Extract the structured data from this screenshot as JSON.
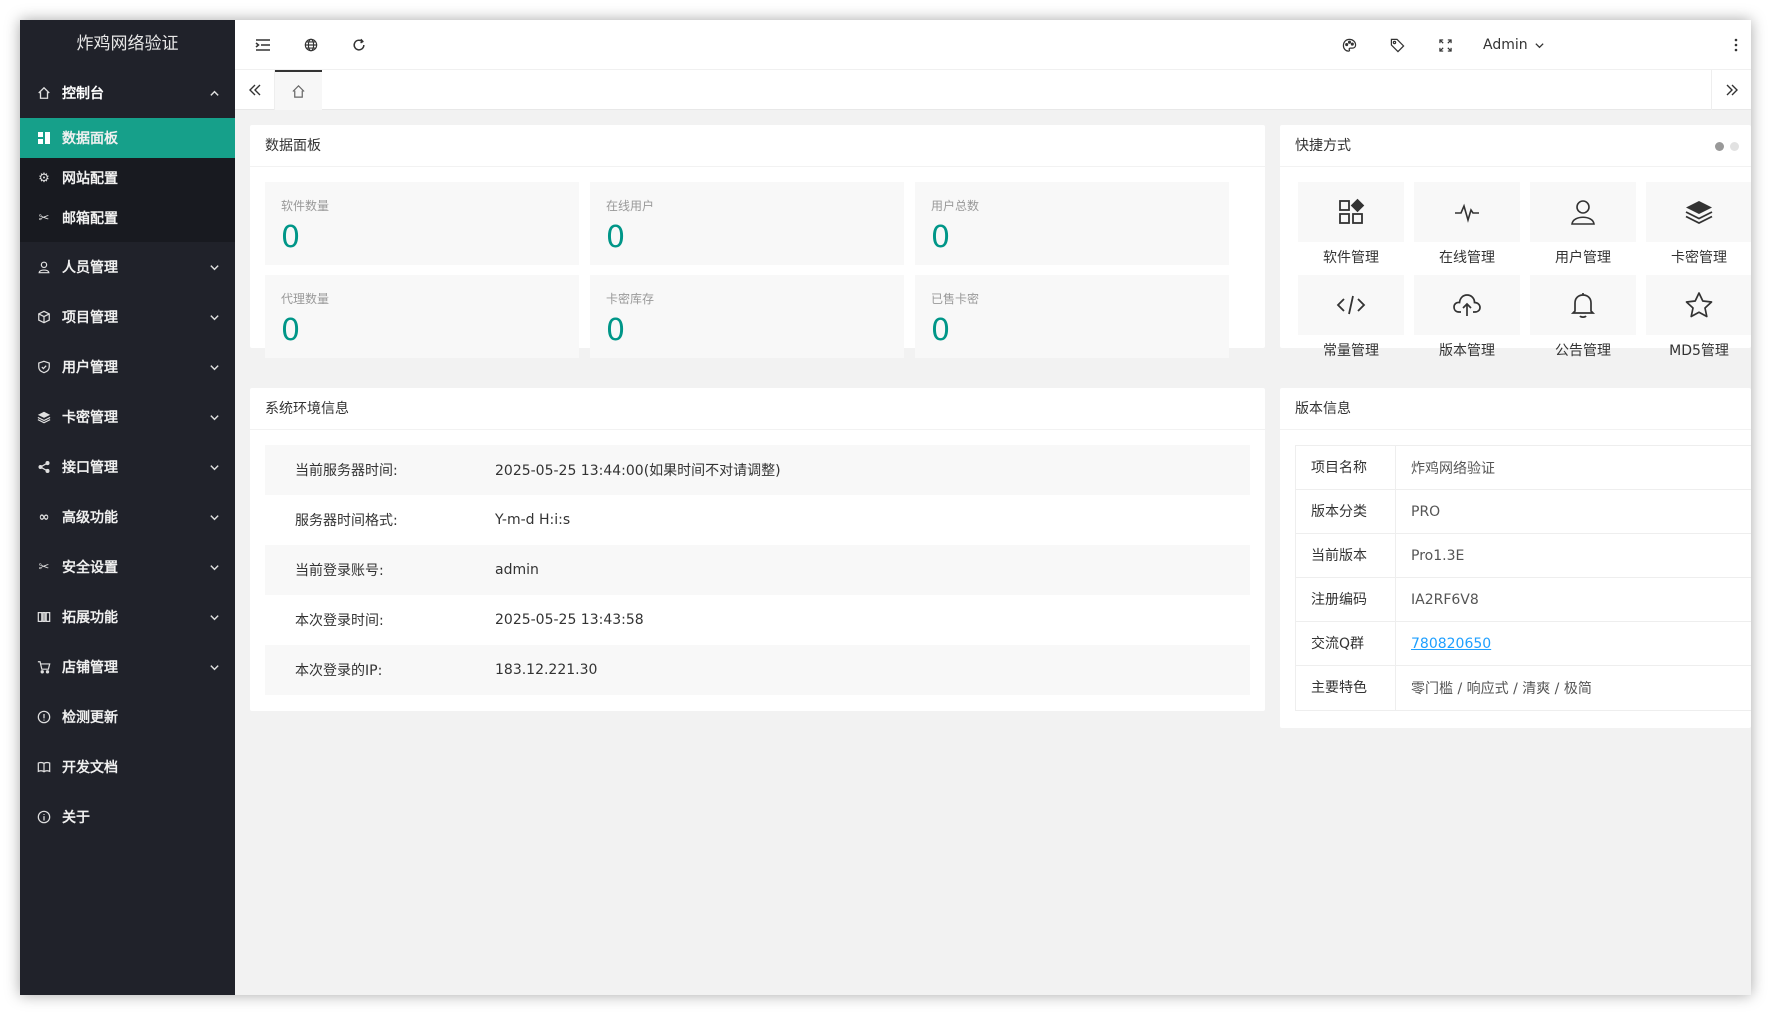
{
  "app": {
    "title": "炸鸡网络验证"
  },
  "sidebar": {
    "console": {
      "label": "控制台",
      "children": [
        {
          "label": "数据面板",
          "active": true
        },
        {
          "label": "网站配置"
        },
        {
          "label": "邮箱配置"
        }
      ]
    },
    "items": [
      {
        "label": "人员管理",
        "icon": "user-icon"
      },
      {
        "label": "项目管理",
        "icon": "box-icon"
      },
      {
        "label": "用户管理",
        "icon": "shield-icon"
      },
      {
        "label": "卡密管理",
        "icon": "layers-icon"
      },
      {
        "label": "接口管理",
        "icon": "share-icon"
      },
      {
        "label": "高级功能",
        "icon": "infinity-icon"
      },
      {
        "label": "安全设置",
        "icon": "tools-icon"
      },
      {
        "label": "拓展功能",
        "icon": "columns-icon"
      },
      {
        "label": "店铺管理",
        "icon": "cart-icon"
      },
      {
        "label": "检测更新",
        "icon": "info-icon"
      },
      {
        "label": "开发文档",
        "icon": "book-icon"
      },
      {
        "label": "关于",
        "icon": "info-icon"
      }
    ]
  },
  "header": {
    "user": "Admin"
  },
  "data_panel": {
    "title": "数据面板",
    "stats": [
      {
        "label": "软件数量",
        "value": "0"
      },
      {
        "label": "在线用户",
        "value": "0"
      },
      {
        "label": "用户总数",
        "value": "0"
      },
      {
        "label": "代理数量",
        "value": "0"
      },
      {
        "label": "卡密库存",
        "value": "0"
      },
      {
        "label": "已售卡密",
        "value": "0"
      }
    ]
  },
  "shortcuts": {
    "title": "快捷方式",
    "items": [
      {
        "label": "软件管理",
        "icon": "apps-icon"
      },
      {
        "label": "在线管理",
        "icon": "pulse-icon"
      },
      {
        "label": "用户管理",
        "icon": "user-icon"
      },
      {
        "label": "卡密管理",
        "icon": "layers-icon"
      },
      {
        "label": "常量管理",
        "icon": "code-icon"
      },
      {
        "label": "版本管理",
        "icon": "cloud-upload-icon"
      },
      {
        "label": "公告管理",
        "icon": "bell-icon"
      },
      {
        "label": "MD5管理",
        "icon": "star-icon"
      }
    ]
  },
  "env": {
    "title": "系统环境信息",
    "rows": [
      {
        "k": "当前服务器时间:",
        "v": "2025-05-25 13:44:00(如果时间不对请调整)"
      },
      {
        "k": "服务器时间格式:",
        "v": "Y-m-d H:i:s"
      },
      {
        "k": "当前登录账号:",
        "v": "admin"
      },
      {
        "k": "本次登录时间:",
        "v": "2025-05-25 13:43:58"
      },
      {
        "k": "本次登录的IP:",
        "v": "183.12.221.30"
      }
    ]
  },
  "version": {
    "title": "版本信息",
    "rows": [
      {
        "k": "项目名称",
        "v": "炸鸡网络验证"
      },
      {
        "k": "版本分类",
        "v": "PRO"
      },
      {
        "k": "当前版本",
        "v": "Pro1.3E"
      },
      {
        "k": "注册编码",
        "v": "IA2RF6V8"
      },
      {
        "k": "交流Q群",
        "v": "780820650"
      },
      {
        "k": "主要特色",
        "v": "零门槛 / 响应式 / 清爽 / 极简"
      }
    ]
  },
  "colors": {
    "accent": "#009688",
    "sidebar": "#20222a",
    "active": "#16a08a",
    "link": "#1e9fff"
  }
}
